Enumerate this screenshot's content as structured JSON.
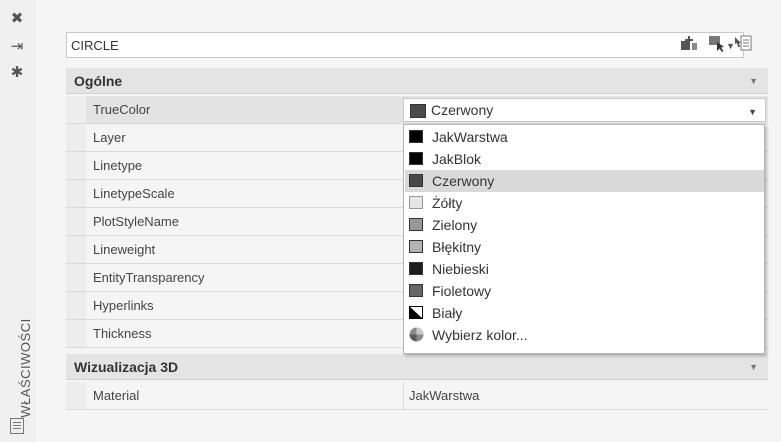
{
  "sidebar": {
    "close_glyph": "✖",
    "pin_glyph": "⇥",
    "settings_glyph": "✱",
    "title": "WŁAŚCIWOŚCI"
  },
  "selector": {
    "value": "CIRCLE"
  },
  "sections": {
    "general": {
      "title": "Ogólne"
    },
    "viz3d": {
      "title": "Wizualizacja 3D"
    }
  },
  "properties": {
    "truecolor": {
      "label": "TrueColor",
      "value": "Czerwony"
    },
    "layer": {
      "label": "Layer"
    },
    "linetype": {
      "label": "Linetype"
    },
    "linetypescale": {
      "label": "LinetypeScale"
    },
    "plotstylename": {
      "label": "PlotStyleName"
    },
    "lineweight": {
      "label": "Lineweight"
    },
    "entitytransparency": {
      "label": "EntityTransparency"
    },
    "hyperlinks": {
      "label": "Hyperlinks"
    },
    "thickness": {
      "label": "Thickness"
    },
    "material": {
      "label": "Material",
      "value": "JakWarstwa"
    }
  },
  "color_options": [
    {
      "label": "JakWarstwa",
      "swatch": "#000000"
    },
    {
      "label": "JakBlok",
      "swatch": "#000000"
    },
    {
      "label": "Czerwony",
      "swatch": "#4a4a4a"
    },
    {
      "label": "Żółty",
      "swatch": "#e6e6e6"
    },
    {
      "label": "Zielony",
      "swatch": "#999999"
    },
    {
      "label": "Błękitny",
      "swatch": "#b3b3b3"
    },
    {
      "label": "Niebieski",
      "swatch": "#1e1e1e"
    },
    {
      "label": "Fioletowy",
      "swatch": "#666666"
    },
    {
      "label": "Biały",
      "swatch": "split"
    },
    {
      "label": "Wybierz kolor...",
      "swatch": "wheel"
    }
  ],
  "colors": {
    "highlight": "#d9d9d9",
    "section_bg": "#e4e4e4",
    "panel_bg": "#f5f5f5"
  }
}
